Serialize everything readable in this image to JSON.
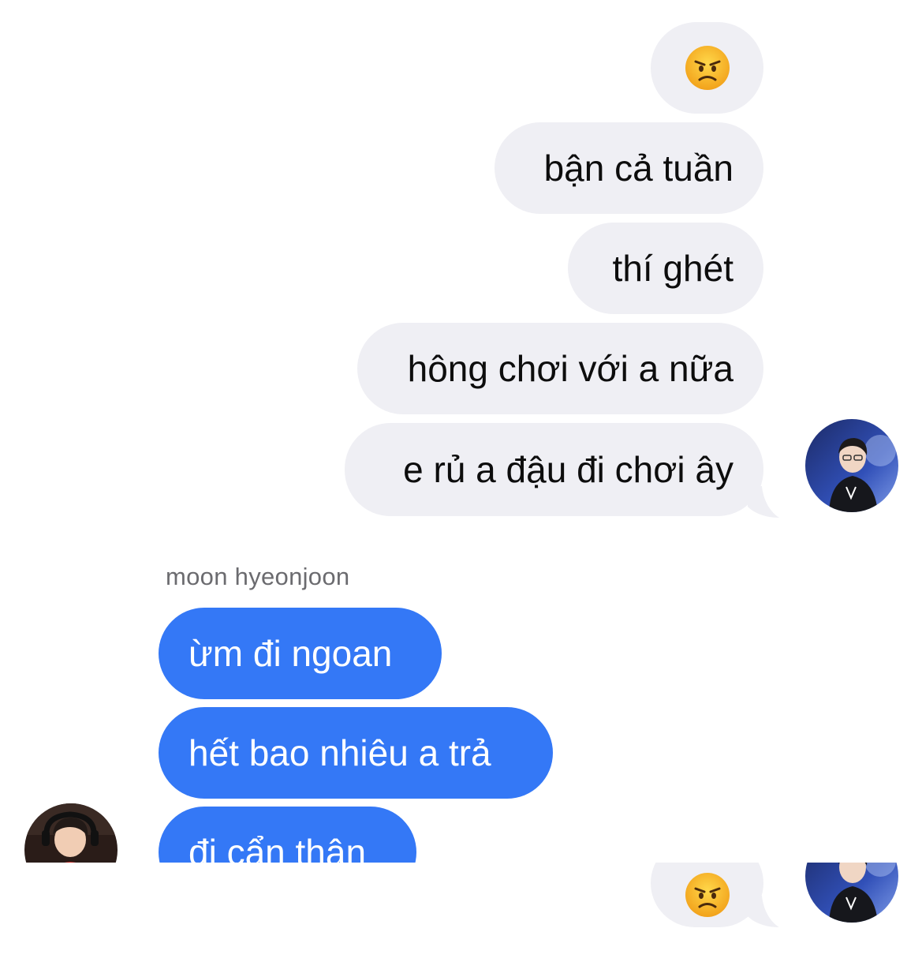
{
  "conversation": {
    "outgoing": [
      {
        "text": "",
        "emoji": "angry-face"
      },
      {
        "text": "bận cả tuần"
      },
      {
        "text": "thí ghét"
      },
      {
        "text": "hông chơi với a nữa"
      },
      {
        "text": "e rủ a đậu đi chơi ây"
      }
    ],
    "incoming_sender": "moon hyeonjoon",
    "incoming": [
      {
        "text": "ừm đi ngoan"
      },
      {
        "text": "hết bao nhiêu a trả"
      },
      {
        "text": "đi cẩn thận"
      }
    ],
    "next_outgoing": {
      "emoji": "angry-face"
    }
  },
  "colors": {
    "outgoing_bubble": "#efeff4",
    "incoming_bubble": "#3478f6",
    "sender_label": "#6b6b6f"
  }
}
